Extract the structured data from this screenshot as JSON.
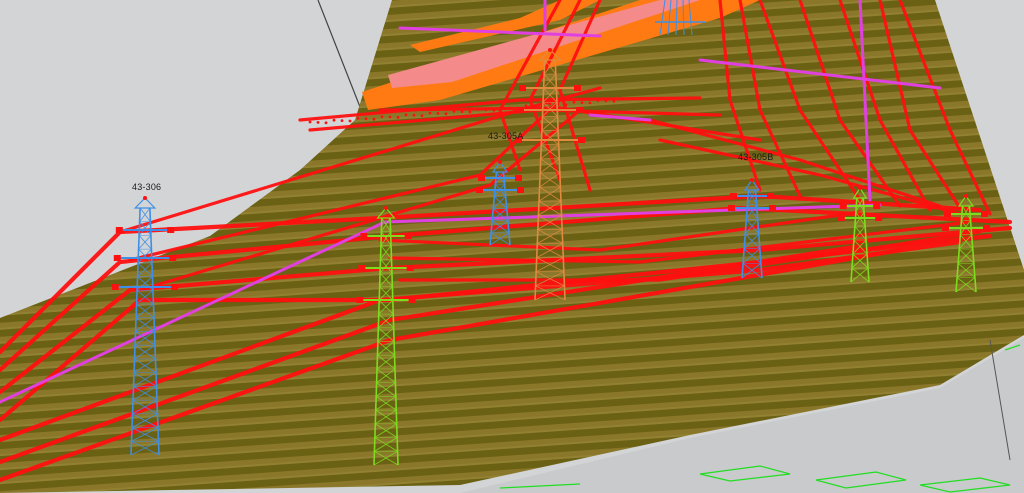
{
  "viewer": {
    "towers": [
      {
        "id": "t1",
        "label": "43-306",
        "color_key": "tower_blue"
      },
      {
        "id": "t2",
        "label": "43-305A",
        "color_key": "tower_blue"
      },
      {
        "id": "t3",
        "label": "43-305B",
        "color_key": "tower_blue"
      },
      {
        "id": "t4",
        "label": "",
        "color_key": "tower_green"
      },
      {
        "id": "t5",
        "label": "",
        "color_key": "tower_green"
      },
      {
        "id": "t6",
        "label": "",
        "color_key": "tower_green"
      },
      {
        "id": "t7",
        "label": "",
        "color_key": "tower_orange"
      }
    ]
  },
  "colors": {
    "background": "#d3d4d6",
    "terrain": "#6e6416",
    "terrain_stripe": "#a08a3a",
    "conductor_red": "#ff1010",
    "conductor_magenta": "#e040e0",
    "tower_blue": "#3f8fe6",
    "tower_green": "#7ddc1e",
    "tower_orange": "#e08a40",
    "road_orange": "#ff7a12",
    "road_pink": "#f58a8a",
    "outline_green": "#22dd22"
  }
}
